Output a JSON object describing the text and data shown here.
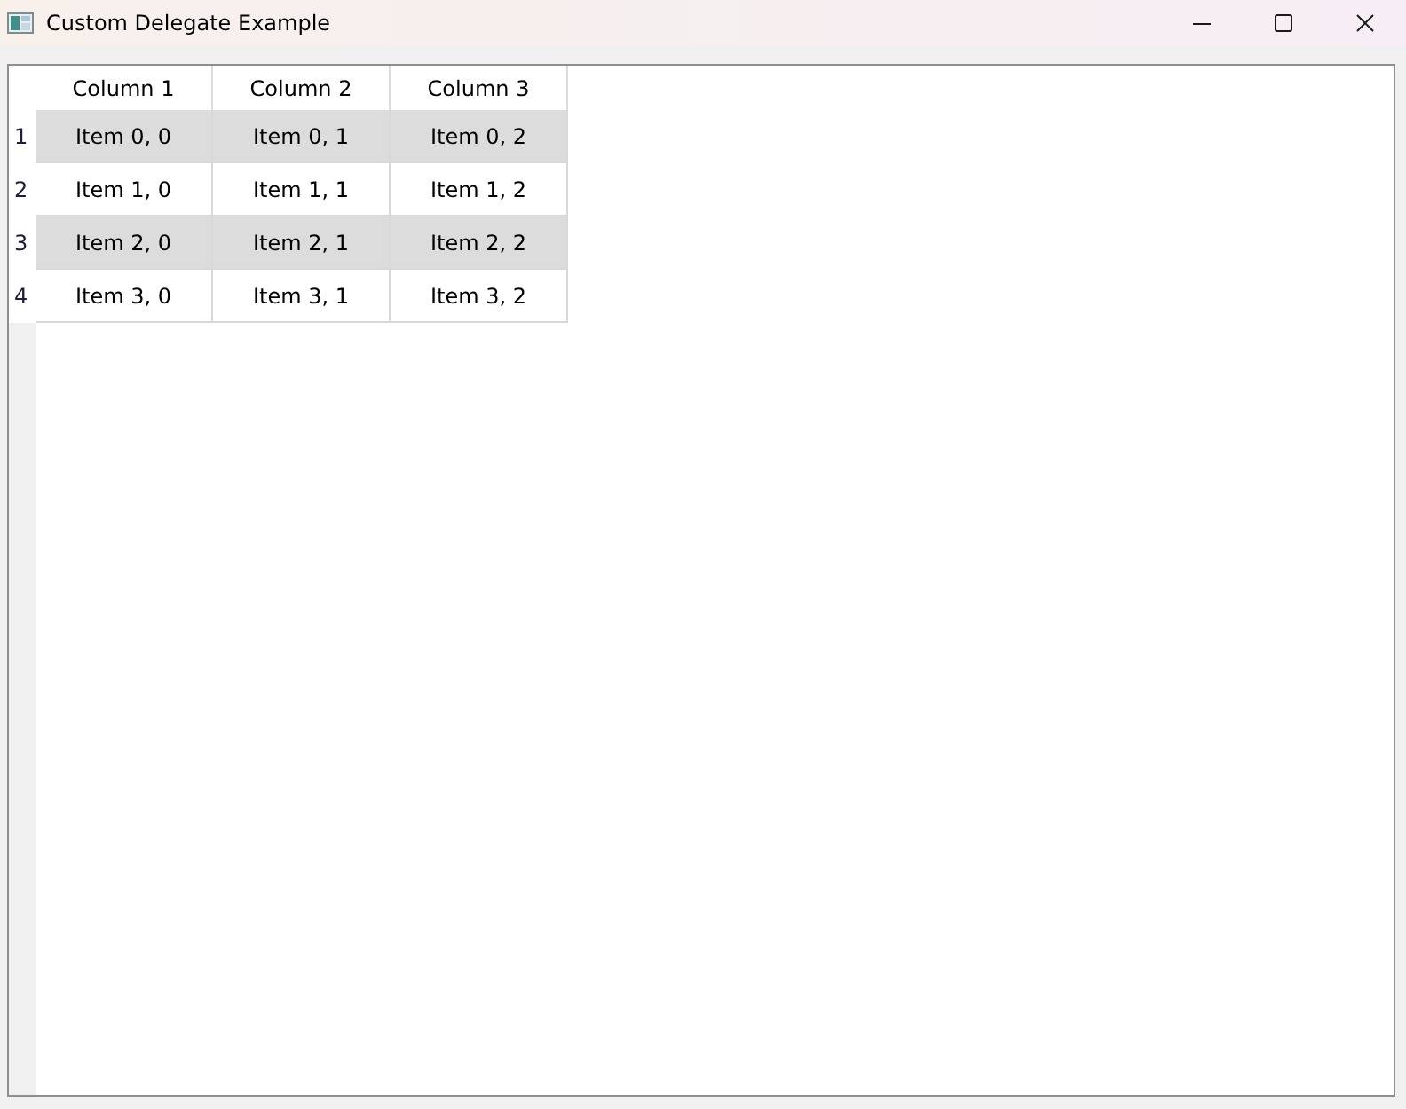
{
  "window": {
    "title": "Custom Delegate Example"
  },
  "table": {
    "columns": [
      "Column 1",
      "Column 2",
      "Column 3"
    ],
    "rows": [
      {
        "header": "1",
        "shaded": true,
        "cells": [
          "Item 0, 0",
          "Item 0, 1",
          "Item 0, 2"
        ]
      },
      {
        "header": "2",
        "shaded": false,
        "cells": [
          "Item 1, 0",
          "Item 1, 1",
          "Item 1, 2"
        ]
      },
      {
        "header": "3",
        "shaded": true,
        "cells": [
          "Item 2, 0",
          "Item 2, 1",
          "Item 2, 2"
        ]
      },
      {
        "header": "4",
        "shaded": false,
        "cells": [
          "Item 3, 0",
          "Item 3, 1",
          "Item 3, 2"
        ]
      }
    ]
  }
}
